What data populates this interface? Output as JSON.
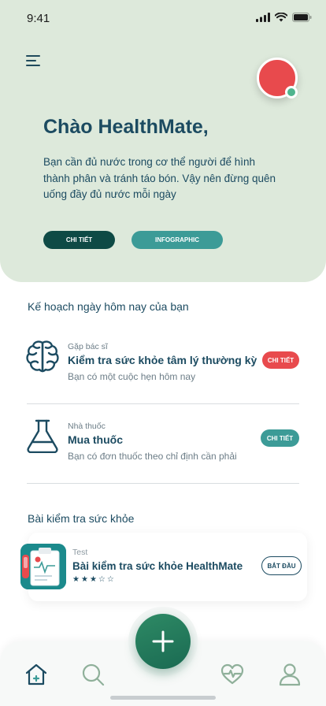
{
  "status_bar": {
    "time": "9:41"
  },
  "hero": {
    "greeting": "Chào HealthMate,",
    "text": "Bạn cần đủ nước trong cơ thể người để hình thành phân và tránh táo bón. Vậy nên đừng quên uống đầy đủ nước mỗi ngày",
    "detail_button": "CHI TIẾT",
    "infographic_button": "INFOGRAPHIC"
  },
  "plan": {
    "title": "Kế hoạch ngày hôm nay của bạn",
    "items": [
      {
        "category": "Gặp bác sĩ",
        "title": "Kiểm tra sức khỏe tâm lý thường kỳ",
        "subtitle": "Bạn có một cuộc hẹn hôm nay",
        "button": "CHI TIẾT",
        "icon": "brain-icon",
        "button_color": "#e84a4d"
      },
      {
        "category": "Nhà thuốc",
        "title": "Mua thuốc",
        "subtitle": "Bạn có đơn thuốc theo chỉ định cần phải",
        "button": "CHI TIẾT",
        "icon": "flask-icon",
        "button_color": "#3c9b97"
      }
    ]
  },
  "tests": {
    "title": "Bài kiểm tra sức khỏe",
    "card": {
      "category": "Test",
      "title": "Bài kiểm tra sức khỏe HealthMate",
      "rating": 3,
      "rating_max": 5,
      "button": "BẮT ĐẦU"
    }
  },
  "nav": {
    "items": [
      "home-icon",
      "search-icon",
      "add-icon",
      "heart-pulse-icon",
      "profile-icon"
    ],
    "active": "home-icon"
  },
  "colors": {
    "hero_bg": "#dde9db",
    "primary_dark": "#1c4b61",
    "teal": "#3c9b97",
    "red": "#e84a4d",
    "green": "#2e8a65"
  }
}
